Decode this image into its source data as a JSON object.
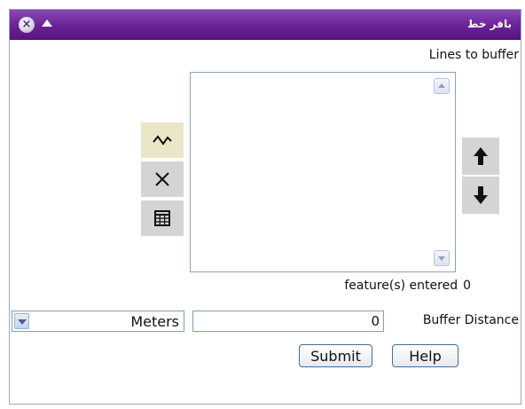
{
  "window": {
    "title": "بافر خط",
    "close_icon": "close-icon",
    "collapse_icon": "collapse-icon"
  },
  "lines_label": "Lines to buffer",
  "tools": [
    {
      "name": "draw-line-icon",
      "active": true
    },
    {
      "name": "clear-icon",
      "active": false
    },
    {
      "name": "table-icon",
      "active": false
    }
  ],
  "move_buttons": [
    "arrow-up-icon",
    "arrow-down-icon"
  ],
  "features": {
    "label": "feature(s) entered",
    "count": "0"
  },
  "unit": {
    "selected": "Meters"
  },
  "buffer": {
    "value": "0",
    "label": "Buffer Distance"
  },
  "buttons": {
    "submit": "Submit",
    "help": "Help"
  },
  "colors": {
    "titlebar": "#6b2498",
    "tool_bg": "#d4d4d4",
    "tool_active_bg": "#eae7c8"
  }
}
